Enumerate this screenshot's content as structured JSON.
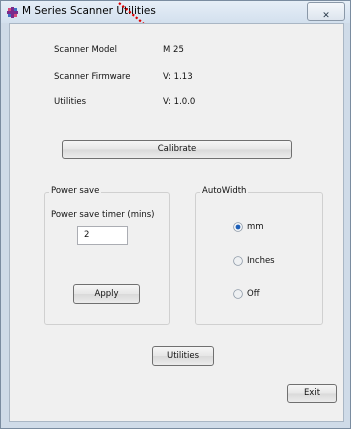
{
  "window": {
    "title": "M Series Scanner Utilities",
    "close_icon": "close-icon",
    "app_icon": "scanner-app-icon"
  },
  "info": {
    "model_label": "Scanner Model",
    "model_value": "M 25",
    "firmware_label": "Scanner Firmware",
    "firmware_value": "V: 1.13",
    "utilities_label": "Utilities",
    "utilities_value": "V: 1.0.0"
  },
  "calibrate_button": "Calibrate",
  "power_save": {
    "group_title": "Power save",
    "timer_label": "Power save timer (mins)",
    "timer_value": "2",
    "apply_button": "Apply"
  },
  "autowidth": {
    "group_title": "AutoWidth",
    "options": [
      {
        "label": "mm",
        "selected": true
      },
      {
        "label": "Inches",
        "selected": false
      },
      {
        "label": "Off",
        "selected": false
      }
    ]
  },
  "utilities_button": "Utilities",
  "exit_button": "Exit",
  "colors": {
    "annotation_arrow": "#e00000",
    "radio_selected": "#1d5fb8"
  }
}
